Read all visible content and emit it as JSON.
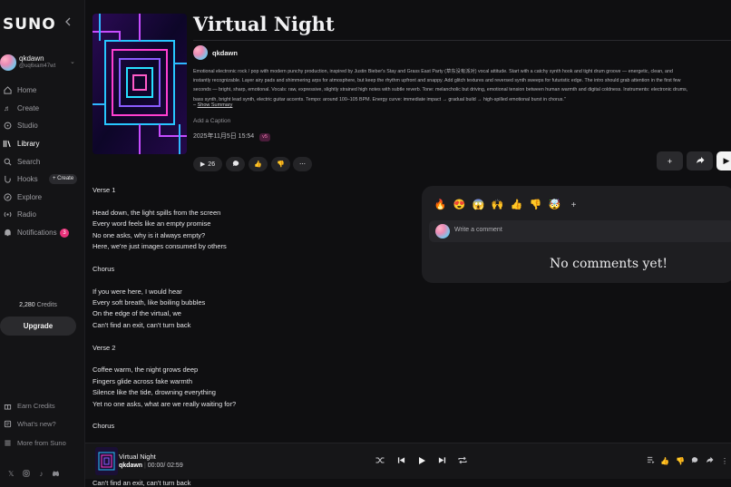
{
  "sidebar": {
    "logo": "SUNO",
    "user": {
      "name": "qkdawn",
      "handle": "@uq6xam47wt"
    },
    "nav": [
      {
        "label": "Home",
        "icon": "home-icon"
      },
      {
        "label": "Create",
        "icon": "create-icon"
      },
      {
        "label": "Studio",
        "icon": "studio-icon"
      },
      {
        "label": "Library",
        "icon": "library-icon",
        "active": true
      },
      {
        "label": "Search",
        "icon": "search-icon"
      },
      {
        "label": "Hooks",
        "icon": "hooks-icon",
        "badge": "+ Create"
      },
      {
        "label": "Explore",
        "icon": "explore-icon"
      },
      {
        "label": "Radio",
        "icon": "radio-icon"
      },
      {
        "label": "Notifications",
        "icon": "bell-icon",
        "count": "3"
      }
    ],
    "credits_value": "2,280",
    "credits_label": "Credits",
    "upgrade_label": "Upgrade",
    "footer_nav": [
      {
        "label": "Earn Credits",
        "icon": "earn-icon"
      },
      {
        "label": "What's new?",
        "icon": "news-icon"
      },
      {
        "label": "More from Suno",
        "icon": "more-icon"
      }
    ],
    "socials": [
      "x-icon",
      "instagram-icon",
      "tiktok-icon",
      "discord-icon"
    ]
  },
  "song": {
    "title": "Virtual Night",
    "owner": "qkdawn",
    "description": "Emotional electronic rock / pop with modern punchy production, inspired by Justin Bieber's Stay and Grass East Party (草东没有派对) vocal attitude. Start with a catchy synth hook and tight drum groove — energetic, clean, and\ninstantly recognizable. Layer airy pads and shimmering arps for atmosphere, but keep the rhythm upfront and snappy. Add glitch textures and reversed synth sweeps for futuristic edge. The intro should grab attention in the first few\nseconds — bright, sharp, emotional. Vocals: raw, expressive, slightly strained high notes with subtle reverb. Tone: melancholic but driving, emotional tension between human warmth and digital coldness. Instruments: electronic drums,\nbass synth, bright lead synth, electric guitar accents. Tempo: around 100–105 BPM. Energy curve: immediate impact → gradual build → high-spilled emotional burst in chorus.\"",
    "show_summary": "Show Summary",
    "add_caption": "Add a Caption",
    "date": "2025年11月5日 15:54",
    "version": "v5",
    "plays": "26"
  },
  "lyrics": [
    "Verse 1",
    "",
    "Head down, the light spills from the screen",
    "Every word feels like an empty promise",
    "No one asks, why is it always empty?",
    "Here, we're just images consumed by others",
    "",
    "Chorus",
    "",
    "If you were here, I would hear",
    "Every soft breath, like boiling bubbles",
    "On the edge of the virtual, we",
    "Can't find an exit, can't turn back",
    "",
    "Verse 2",
    "",
    "Coffee warm, the night grows deep",
    "Fingers glide across fake warmth",
    "Silence like the tide, drowning everything",
    "Yet no one asks, what are we really waiting for?",
    "",
    "Chorus"
  ],
  "lyrics_cutoff": "Can't find an exit, can't turn back",
  "comments": {
    "emojis": [
      "🔥",
      "😍",
      "😱",
      "🙌",
      "👍",
      "👎",
      "🤯"
    ],
    "placeholder": "Write a comment",
    "empty_text": "No comments yet!"
  },
  "player": {
    "title": "Virtual Night",
    "artist": "qkdawn",
    "current": "00:00",
    "duration": "02:59"
  },
  "colors": {
    "accent_pink": "#e8327a",
    "background": "#0f0f11",
    "panel": "#1e1e21"
  }
}
